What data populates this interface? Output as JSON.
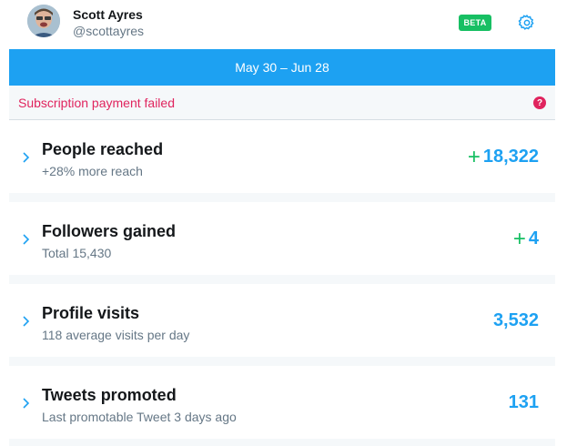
{
  "user": {
    "name": "Scott Ayres",
    "handle": "@scottayres"
  },
  "badge": {
    "label": "BETA"
  },
  "icons": {
    "settings": "gear-icon",
    "help": "question-circle-icon",
    "expand": "chevron-right-icon"
  },
  "date_range": "May 30 – Jun 28",
  "alert": {
    "text": "Subscription payment failed",
    "help_glyph": "?"
  },
  "stats": [
    {
      "title": "People reached",
      "subtitle": "+28% more reach",
      "prefix": "+",
      "value": "18,322"
    },
    {
      "title": "Followers gained",
      "subtitle": "Total 15,430",
      "prefix": "+",
      "value": "4"
    },
    {
      "title": "Profile visits",
      "subtitle": "118 average visits per day",
      "prefix": "",
      "value": "3,532"
    },
    {
      "title": "Tweets promoted",
      "subtitle": "Last promotable Tweet 3 days ago",
      "prefix": "",
      "value": "131"
    }
  ],
  "colors": {
    "accent": "#1da1f2",
    "positive": "#17bf63",
    "error": "#e0245e",
    "text_primary": "#14171a",
    "text_secondary": "#657786",
    "panel_bg": "#f5f8fa"
  }
}
